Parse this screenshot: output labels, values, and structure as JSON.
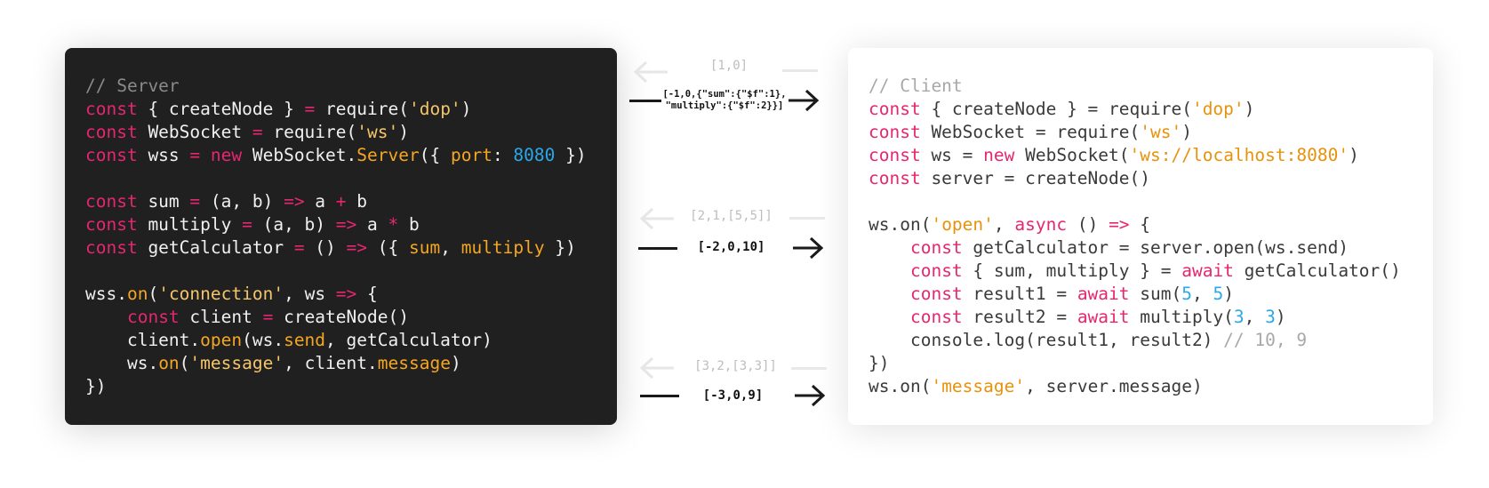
{
  "server": {
    "lines": [
      [
        {
          "t": "// Server",
          "c": "comment"
        }
      ],
      [
        {
          "t": "const",
          "c": "kw"
        },
        {
          "t": " { createNode } "
        },
        {
          "t": "=",
          "c": "op"
        },
        {
          "t": " require("
        },
        {
          "t": "'dop'",
          "c": "str"
        },
        {
          "t": ")"
        }
      ],
      [
        {
          "t": "const",
          "c": "kw"
        },
        {
          "t": " WebSocket "
        },
        {
          "t": "=",
          "c": "op"
        },
        {
          "t": " require("
        },
        {
          "t": "'ws'",
          "c": "str"
        },
        {
          "t": ")"
        }
      ],
      [
        {
          "t": "const",
          "c": "kw"
        },
        {
          "t": " wss "
        },
        {
          "t": "=",
          "c": "op"
        },
        {
          "t": " "
        },
        {
          "t": "new",
          "c": "kw"
        },
        {
          "t": " WebSocket."
        },
        {
          "t": "Server",
          "c": "fn"
        },
        {
          "t": "({ "
        },
        {
          "t": "port",
          "c": "fn"
        },
        {
          "t": ": "
        },
        {
          "t": "8080",
          "c": "num"
        },
        {
          "t": " })"
        }
      ],
      [],
      [
        {
          "t": "const",
          "c": "kw"
        },
        {
          "t": " sum "
        },
        {
          "t": "=",
          "c": "op"
        },
        {
          "t": " (a, b) "
        },
        {
          "t": "=>",
          "c": "op"
        },
        {
          "t": " a "
        },
        {
          "t": "+",
          "c": "op"
        },
        {
          "t": " b"
        }
      ],
      [
        {
          "t": "const",
          "c": "kw"
        },
        {
          "t": " multiply "
        },
        {
          "t": "=",
          "c": "op"
        },
        {
          "t": " (a, b) "
        },
        {
          "t": "=>",
          "c": "op"
        },
        {
          "t": " a "
        },
        {
          "t": "*",
          "c": "op"
        },
        {
          "t": " b"
        }
      ],
      [
        {
          "t": "const",
          "c": "kw"
        },
        {
          "t": " getCalculator "
        },
        {
          "t": "=",
          "c": "op"
        },
        {
          "t": " () "
        },
        {
          "t": "=>",
          "c": "op"
        },
        {
          "t": " ({ "
        },
        {
          "t": "sum",
          "c": "fn"
        },
        {
          "t": ", "
        },
        {
          "t": "multiply",
          "c": "fn"
        },
        {
          "t": " })"
        }
      ],
      [],
      [
        {
          "t": "wss."
        },
        {
          "t": "on",
          "c": "fn"
        },
        {
          "t": "("
        },
        {
          "t": "'connection'",
          "c": "str"
        },
        {
          "t": ", ws "
        },
        {
          "t": "=>",
          "c": "op"
        },
        {
          "t": " {"
        }
      ],
      [
        {
          "t": "    "
        },
        {
          "t": "const",
          "c": "kw"
        },
        {
          "t": " client "
        },
        {
          "t": "=",
          "c": "op"
        },
        {
          "t": " createNode()"
        }
      ],
      [
        {
          "t": "    client."
        },
        {
          "t": "open",
          "c": "fn"
        },
        {
          "t": "(ws."
        },
        {
          "t": "send",
          "c": "fn"
        },
        {
          "t": ", getCalculator)"
        }
      ],
      [
        {
          "t": "    ws."
        },
        {
          "t": "on",
          "c": "fn"
        },
        {
          "t": "("
        },
        {
          "t": "'message'",
          "c": "str"
        },
        {
          "t": ", client."
        },
        {
          "t": "message",
          "c": "fn"
        },
        {
          "t": ")"
        }
      ],
      [
        {
          "t": "})"
        }
      ]
    ]
  },
  "client": {
    "lines": [
      [
        {
          "t": "// Client",
          "c": "comment"
        }
      ],
      [
        {
          "t": "const",
          "c": "kw"
        },
        {
          "t": " { createNode } = require("
        },
        {
          "t": "'dop'",
          "c": "str"
        },
        {
          "t": ")"
        }
      ],
      [
        {
          "t": "const",
          "c": "kw"
        },
        {
          "t": " WebSocket = require("
        },
        {
          "t": "'ws'",
          "c": "str"
        },
        {
          "t": ")"
        }
      ],
      [
        {
          "t": "const",
          "c": "kw"
        },
        {
          "t": " ws = "
        },
        {
          "t": "new",
          "c": "kw"
        },
        {
          "t": " WebSocket("
        },
        {
          "t": "'ws://localhost:8080'",
          "c": "str"
        },
        {
          "t": ")"
        }
      ],
      [
        {
          "t": "const",
          "c": "kw"
        },
        {
          "t": " server = createNode()"
        }
      ],
      [],
      [
        {
          "t": "ws.on("
        },
        {
          "t": "'open'",
          "c": "str"
        },
        {
          "t": ", "
        },
        {
          "t": "async",
          "c": "kw"
        },
        {
          "t": " () "
        },
        {
          "t": "=>",
          "c": "kw"
        },
        {
          "t": " {"
        }
      ],
      [
        {
          "t": "    "
        },
        {
          "t": "const",
          "c": "kw"
        },
        {
          "t": " getCalculator = server.open(ws.send)"
        }
      ],
      [
        {
          "t": "    "
        },
        {
          "t": "const",
          "c": "kw"
        },
        {
          "t": " { sum, multiply } = "
        },
        {
          "t": "await",
          "c": "kw"
        },
        {
          "t": " getCalculator()"
        }
      ],
      [
        {
          "t": "    "
        },
        {
          "t": "const",
          "c": "kw"
        },
        {
          "t": " result1 = "
        },
        {
          "t": "await",
          "c": "kw"
        },
        {
          "t": " sum("
        },
        {
          "t": "5",
          "c": "num"
        },
        {
          "t": ", "
        },
        {
          "t": "5",
          "c": "num"
        },
        {
          "t": ")"
        }
      ],
      [
        {
          "t": "    "
        },
        {
          "t": "const",
          "c": "kw"
        },
        {
          "t": " result2 = "
        },
        {
          "t": "await",
          "c": "kw"
        },
        {
          "t": " multiply("
        },
        {
          "t": "3",
          "c": "num"
        },
        {
          "t": ", "
        },
        {
          "t": "3",
          "c": "num"
        },
        {
          "t": ")"
        }
      ],
      [
        {
          "t": "    console.log(result1, result2) "
        },
        {
          "t": "// 10, 9",
          "c": "comment"
        }
      ],
      [
        {
          "t": "})"
        }
      ],
      [
        {
          "t": "ws.on("
        },
        {
          "t": "'message'",
          "c": "str"
        },
        {
          "t": ", server.message)"
        }
      ]
    ]
  },
  "messages": [
    {
      "incoming": "[1,0]",
      "outgoing": "[-1,0,{\"sum\":{\"$f\":1},\n\"multiply\":{\"$f\":2}}]"
    },
    {
      "incoming": "[2,1,[5,5]]",
      "outgoing": "[-2,0,10]"
    },
    {
      "incoming": "[3,2,[3,3]]",
      "outgoing": "[-3,0,9]"
    }
  ]
}
